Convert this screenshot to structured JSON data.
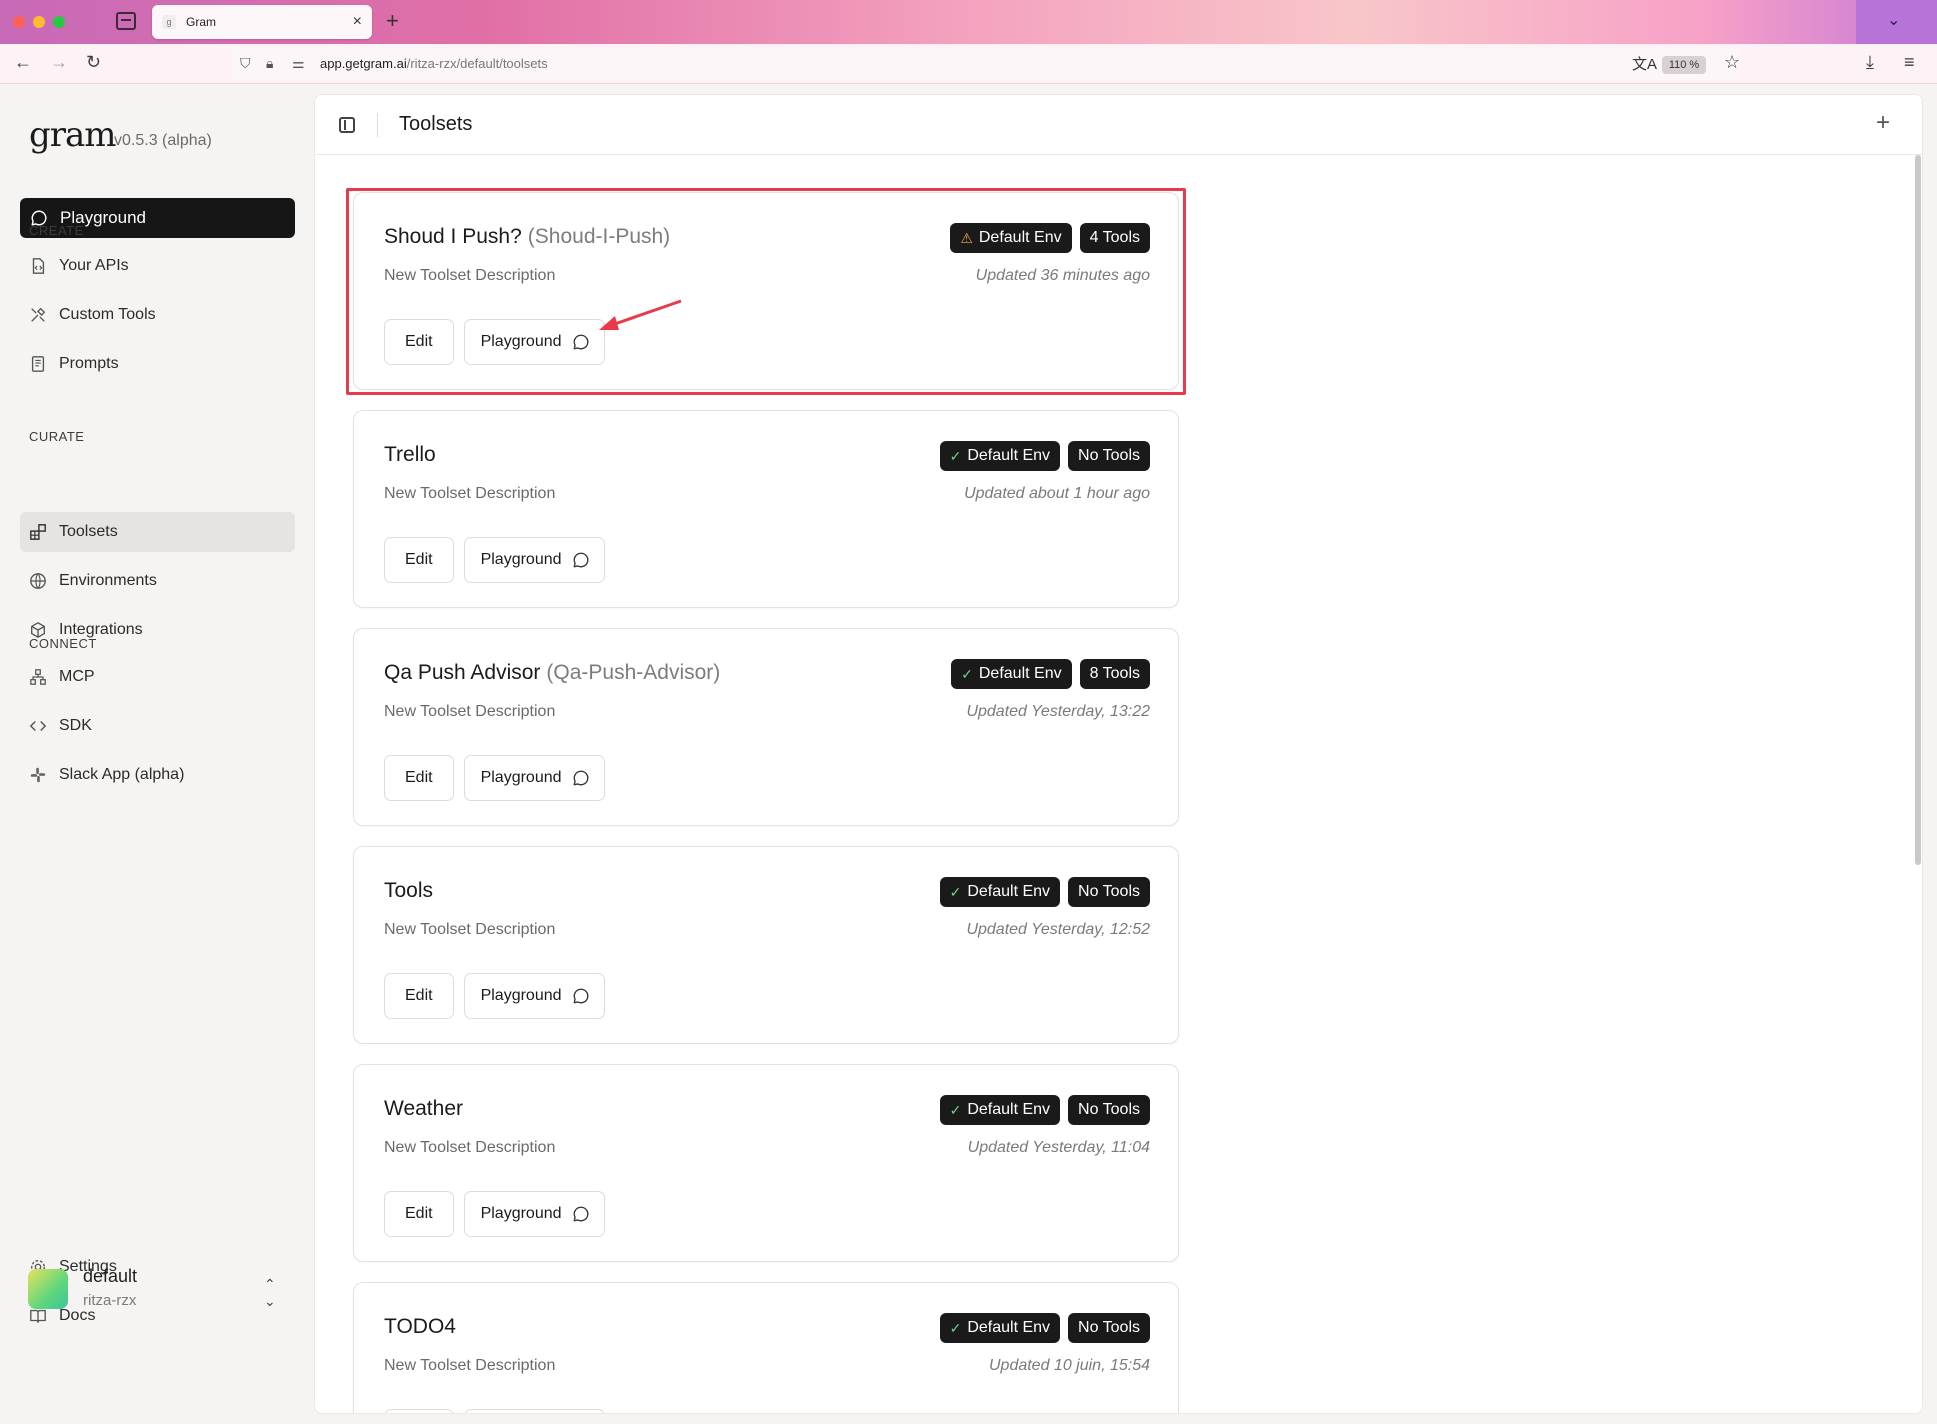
{
  "browser": {
    "tab_title": "Gram",
    "favicon": "g",
    "url_host": "app.getgram.ai",
    "url_path": "/ritza-rzx/default/toolsets",
    "zoom": "110 %"
  },
  "sidebar": {
    "logo": "gram",
    "version": "v0.5.3 (alpha)",
    "primary": "Playground",
    "sections": [
      {
        "label": "CREATE",
        "items": [
          "Your APIs",
          "Custom Tools",
          "Prompts"
        ]
      },
      {
        "label": "CURATE",
        "items": [
          "Toolsets",
          "Environments",
          "Integrations"
        ]
      },
      {
        "label": "CONNECT",
        "items": [
          "MCP",
          "SDK",
          "Slack App (alpha)"
        ]
      }
    ],
    "footer_items": [
      "Settings",
      "Docs"
    ],
    "user": {
      "name": "default",
      "org": "ritza-rzx"
    }
  },
  "header": {
    "title": "Toolsets"
  },
  "cards": [
    {
      "name": "Shoud I Push?",
      "slug": "(Shoud-I-Push)",
      "env_badge": "Default Env",
      "env_status": "warning",
      "tools_badge": "4 Tools",
      "description": "New Toolset Description",
      "updated": "Updated 36 minutes ago",
      "edit": "Edit",
      "playground": "Playground"
    },
    {
      "name": "Trello",
      "slug": "",
      "env_badge": "Default Env",
      "env_status": "ok",
      "tools_badge": "No Tools",
      "description": "New Toolset Description",
      "updated": "Updated about 1 hour ago",
      "edit": "Edit",
      "playground": "Playground"
    },
    {
      "name": "Qa Push Advisor",
      "slug": "(Qa-Push-Advisor)",
      "env_badge": "Default Env",
      "env_status": "ok",
      "tools_badge": "8 Tools",
      "description": "New Toolset Description",
      "updated": "Updated Yesterday, 13:22",
      "edit": "Edit",
      "playground": "Playground"
    },
    {
      "name": "Tools",
      "slug": "",
      "env_badge": "Default Env",
      "env_status": "ok",
      "tools_badge": "No Tools",
      "description": "New Toolset Description",
      "updated": "Updated Yesterday, 12:52",
      "edit": "Edit",
      "playground": "Playground"
    },
    {
      "name": "Weather",
      "slug": "",
      "env_badge": "Default Env",
      "env_status": "ok",
      "tools_badge": "No Tools",
      "description": "New Toolset Description",
      "updated": "Updated Yesterday, 11:04",
      "edit": "Edit",
      "playground": "Playground"
    },
    {
      "name": "TODO4",
      "slug": "",
      "env_badge": "Default Env",
      "env_status": "ok",
      "tools_badge": "No Tools",
      "description": "New Toolset Description",
      "updated": "Updated 10 juin, 15:54",
      "edit": "Edit",
      "playground": "Playground"
    }
  ],
  "annotation": {
    "color": "#e83a4a"
  }
}
